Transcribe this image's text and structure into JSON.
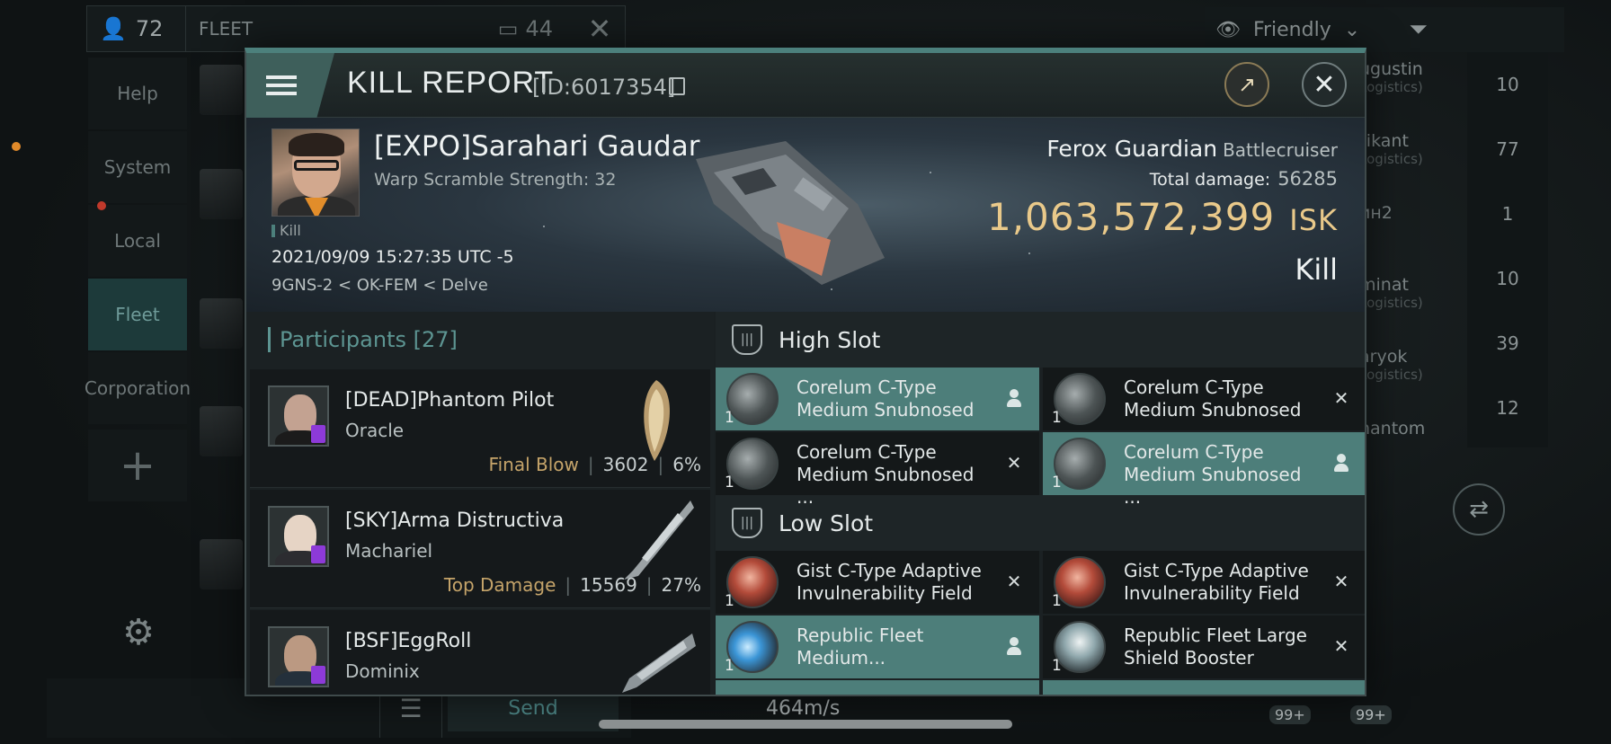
{
  "background": {
    "fleet": {
      "member_count": "72",
      "title": "FLEET",
      "chat_count": "44",
      "menu": [
        "Help",
        "System",
        "Local",
        "Fleet",
        "Corporation"
      ],
      "active_menu": "Fleet",
      "send_label": "Send",
      "speed": "464m/s"
    },
    "overview": {
      "filter_label": "Friendly",
      "names": [
        {
          "name": "ugustin",
          "sub": "Logistics)"
        },
        {
          "name": "rikant",
          "sub": "Logistics)"
        },
        {
          "name": "ин2",
          "sub": ""
        },
        {
          "name": "minat",
          "sub": "Logistics)"
        },
        {
          "name": "aryok",
          "sub": "Logistics)"
        },
        {
          "name": "hantom",
          "sub": ""
        }
      ],
      "numbers": [
        "10",
        "77",
        "1",
        "10",
        "39",
        "12"
      ],
      "badges": [
        "99+",
        "99+"
      ]
    }
  },
  "kill_report": {
    "title": "KILL REPORT",
    "id_label": "[ID:6017354]",
    "victim": {
      "name": "[EXPO]Sarahari Gaudar",
      "warp_scramble": "Warp Scramble Strength: 32",
      "flag": "Kill",
      "timestamp": "2021/09/09 15:27:35 UTC -5",
      "location": "9GNS-2 < OK-FEM < Delve"
    },
    "ship": {
      "name": "Ferox Guardian",
      "class": "Battlecruiser",
      "total_damage_label": "Total damage:",
      "total_damage": "56285",
      "isk_value": "1,063,572,399",
      "isk_unit": "ISK",
      "type": "Kill"
    },
    "participants": {
      "label": "Participants",
      "count": "[27]",
      "items": [
        {
          "name": "[DEAD]Phantom Pilot",
          "ship": "Oracle",
          "tag": "Final Blow",
          "damage": "3602",
          "percent": "6%"
        },
        {
          "name": "[SKY]Arma Distructiva",
          "ship": "Machariel",
          "tag": "Top Damage",
          "damage": "15569",
          "percent": "27%"
        },
        {
          "name": "[BSF]EggRoll",
          "ship": "Dominix",
          "tag": "",
          "damage": "",
          "percent": ""
        }
      ]
    },
    "high_slot": {
      "title": "High Slot",
      "modules": [
        {
          "name": "Corelum C-Type Medium Snubnosed ...",
          "qty": "1",
          "status": "equipped",
          "icon": "turret-icon"
        },
        {
          "name": "Corelum C-Type Medium Snubnosed ...",
          "qty": "1",
          "status": "destroyed",
          "icon": "turret-icon"
        },
        {
          "name": "Corelum C-Type Medium Snubnosed ...",
          "qty": "1",
          "status": "destroyed",
          "icon": "turret-icon"
        },
        {
          "name": "Corelum C-Type Medium Snubnosed ...",
          "qty": "1",
          "status": "equipped",
          "icon": "turret-icon"
        }
      ]
    },
    "low_slot": {
      "title": "Low Slot",
      "modules": [
        {
          "name": "Gist C-Type Adaptive Invulnerability Field",
          "qty": "1",
          "status": "destroyed",
          "icon": "shield-hardener-icon"
        },
        {
          "name": "Gist C-Type Adaptive Invulnerability Field",
          "qty": "1",
          "status": "destroyed",
          "icon": "shield-hardener-icon"
        },
        {
          "name": "Republic Fleet Medium...",
          "qty": "1",
          "status": "equipped",
          "icon": "booster-icon"
        },
        {
          "name": "Republic Fleet Large Shield Booster",
          "qty": "1",
          "status": "destroyed",
          "icon": "shield-booster-icon"
        }
      ]
    }
  }
}
